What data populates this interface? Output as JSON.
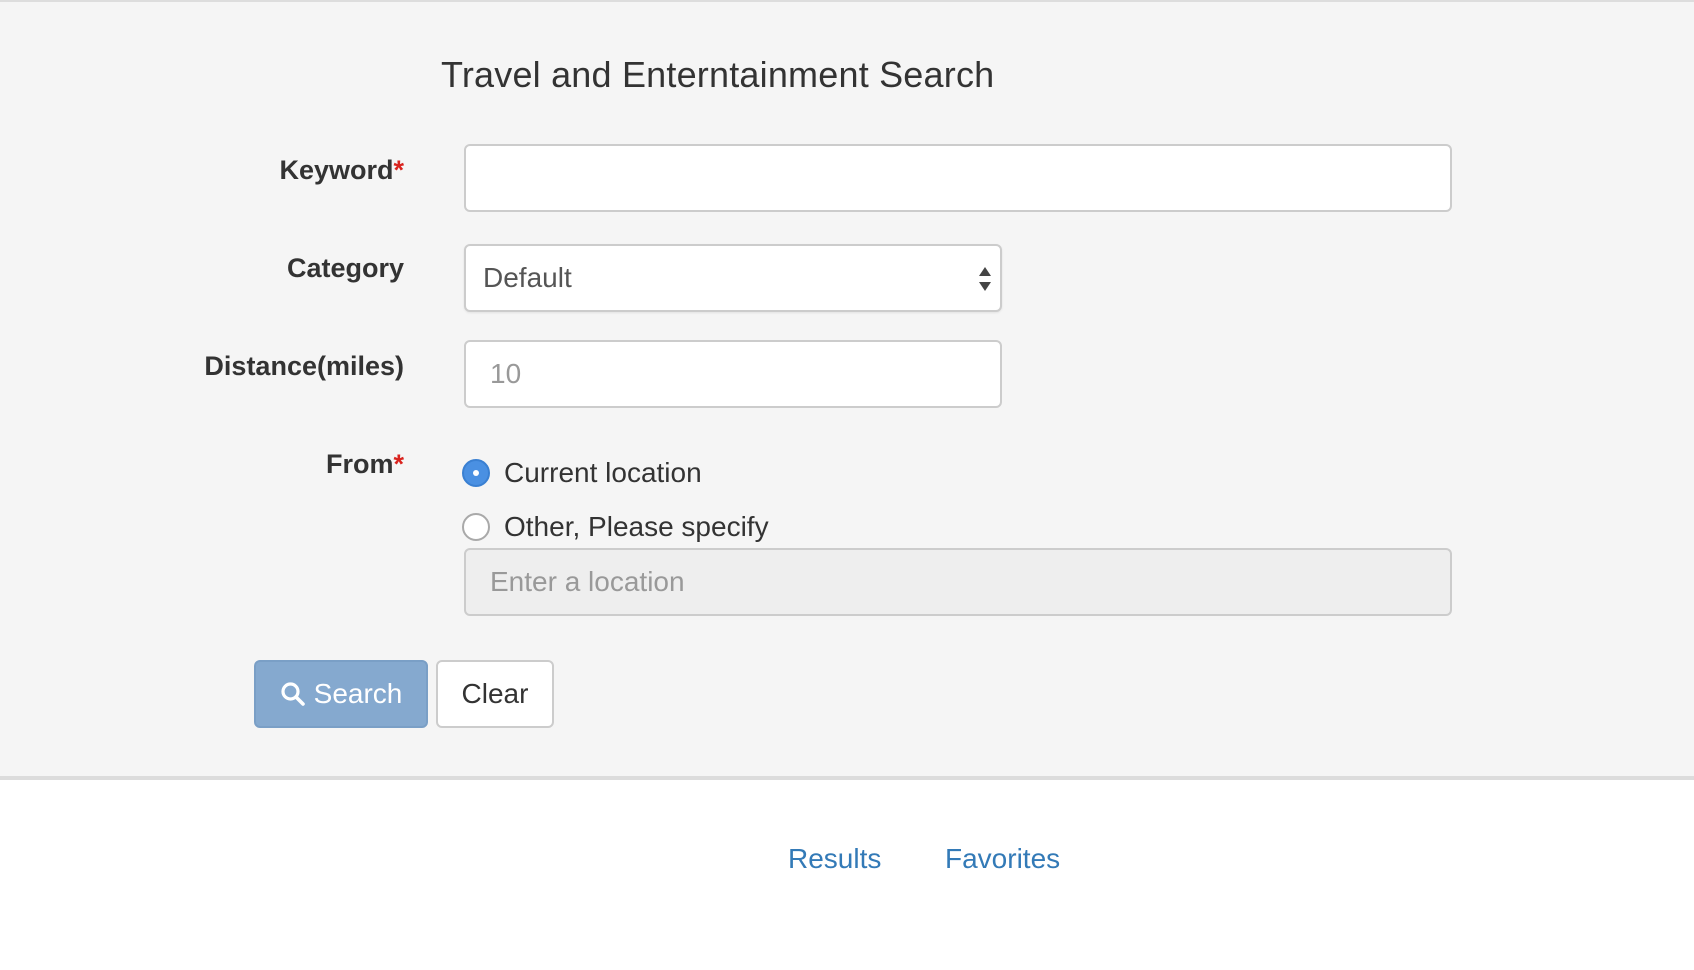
{
  "page": {
    "title": "Travel and Enterntainment Search"
  },
  "form": {
    "keyword": {
      "label": "Keyword",
      "required_mark": "*",
      "value": "",
      "placeholder": ""
    },
    "category": {
      "label": "Category",
      "selected": "Default"
    },
    "distance": {
      "label": "Distance(miles)",
      "value": "",
      "placeholder": "10"
    },
    "from": {
      "label": "From",
      "required_mark": "*",
      "options": [
        {
          "label": "Current location",
          "checked": true
        },
        {
          "label": "Other, Please specify",
          "checked": false
        }
      ],
      "location_input": {
        "value": "",
        "placeholder": "Enter a location",
        "disabled": true
      }
    }
  },
  "buttons": {
    "search_label": "Search",
    "clear_label": "Clear"
  },
  "tabs": [
    {
      "label": "Results"
    },
    {
      "label": "Favorites"
    }
  ],
  "colors": {
    "panel_bg": "#f5f5f5",
    "required": "#d9231e",
    "radio_checked": "#4a90e2",
    "search_button": "#85a9cf",
    "link": "#337ab7"
  },
  "icons": {
    "search_button": "search-icon",
    "select_arrows": "select-arrows-icon"
  }
}
